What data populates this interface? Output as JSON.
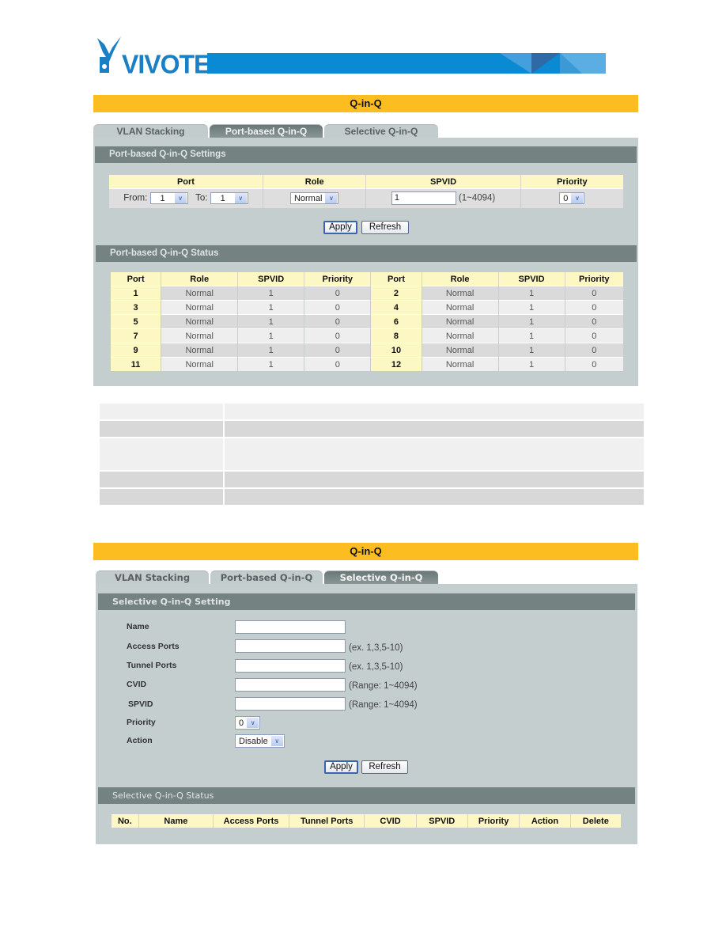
{
  "brand": {
    "name": "VIVOTEK",
    "primary_color": "#0a8ad2",
    "title_bar_color": "#fbbd20"
  },
  "panel1": {
    "title": "Q-in-Q",
    "tabs": [
      {
        "label": "VLAN Stacking",
        "active": false
      },
      {
        "label": "Port-based Q-in-Q",
        "active": true
      },
      {
        "label": "Selective Q-in-Q",
        "active": false
      }
    ],
    "settings": {
      "section_title": "Port-based Q-in-Q Settings",
      "headers": [
        "Port",
        "Role",
        "SPVID",
        "Priority"
      ],
      "from_label": "From:",
      "from_value": "1",
      "to_label": "To:",
      "to_value": "1",
      "role_value": "Normal",
      "spvid_value": "1",
      "spvid_hint": "(1~4094)",
      "priority_value": "0",
      "apply_label": "Apply",
      "refresh_label": "Refresh"
    },
    "status": {
      "section_title": "Port-based Q-in-Q Status",
      "headers": [
        "Port",
        "Role",
        "SPVID",
        "Priority",
        "Port",
        "Role",
        "SPVID",
        "Priority"
      ],
      "rows": [
        {
          "port_a": "1",
          "role_a": "Normal",
          "spvid_a": "1",
          "prio_a": "0",
          "port_b": "2",
          "role_b": "Normal",
          "spvid_b": "1",
          "prio_b": "0"
        },
        {
          "port_a": "3",
          "role_a": "Normal",
          "spvid_a": "1",
          "prio_a": "0",
          "port_b": "4",
          "role_b": "Normal",
          "spvid_b": "1",
          "prio_b": "0"
        },
        {
          "port_a": "5",
          "role_a": "Normal",
          "spvid_a": "1",
          "prio_a": "0",
          "port_b": "6",
          "role_b": "Normal",
          "spvid_b": "1",
          "prio_b": "0"
        },
        {
          "port_a": "7",
          "role_a": "Normal",
          "spvid_a": "1",
          "prio_a": "0",
          "port_b": "8",
          "role_b": "Normal",
          "spvid_b": "1",
          "prio_b": "0"
        },
        {
          "port_a": "9",
          "role_a": "Normal",
          "spvid_a": "1",
          "prio_a": "0",
          "port_b": "10",
          "role_b": "Normal",
          "spvid_b": "1",
          "prio_b": "0"
        },
        {
          "port_a": "11",
          "role_a": "Normal",
          "spvid_a": "1",
          "prio_a": "0",
          "port_b": "12",
          "role_b": "Normal",
          "spvid_b": "1",
          "prio_b": "0"
        }
      ]
    }
  },
  "description_table": {
    "rows": [
      {
        "label": "",
        "text": ""
      },
      {
        "label": "",
        "text": ""
      },
      {
        "label": "",
        "text": ""
      },
      {
        "label": "",
        "text": ""
      },
      {
        "label": "",
        "text": ""
      }
    ]
  },
  "panel2": {
    "title": "Q-in-Q",
    "tabs": [
      {
        "label": "VLAN Stacking",
        "active": false
      },
      {
        "label": "Port-based Q-in-Q",
        "active": false
      },
      {
        "label": "Selective Q-in-Q",
        "active": true
      }
    ],
    "setting": {
      "section_title": "Selective Q-in-Q Setting",
      "fields": {
        "name": {
          "label": "Name",
          "value": "",
          "hint": ""
        },
        "access_ports": {
          "label": "Access Ports",
          "value": "",
          "hint": "(ex. 1,3,5-10)"
        },
        "tunnel_ports": {
          "label": "Tunnel Ports",
          "value": "",
          "hint": "(ex. 1,3,5-10)"
        },
        "cvid": {
          "label": "CVID",
          "value": "",
          "hint": "(Range: 1~4094)"
        },
        "spvid": {
          "label": "SPVID",
          "value": "",
          "hint": "(Range: 1~4094)"
        },
        "priority": {
          "label": "Priority",
          "value": "0"
        },
        "action": {
          "label": "Action",
          "value": "Disable"
        }
      },
      "apply_label": "Apply",
      "refresh_label": "Refresh"
    },
    "status": {
      "section_title": "Selective Q-in-Q Status",
      "headers": [
        "No.",
        "Name",
        "Access Ports",
        "Tunnel Ports",
        "CVID",
        "SPVID",
        "Priority",
        "Action",
        "Delete"
      ],
      "rows": []
    }
  }
}
